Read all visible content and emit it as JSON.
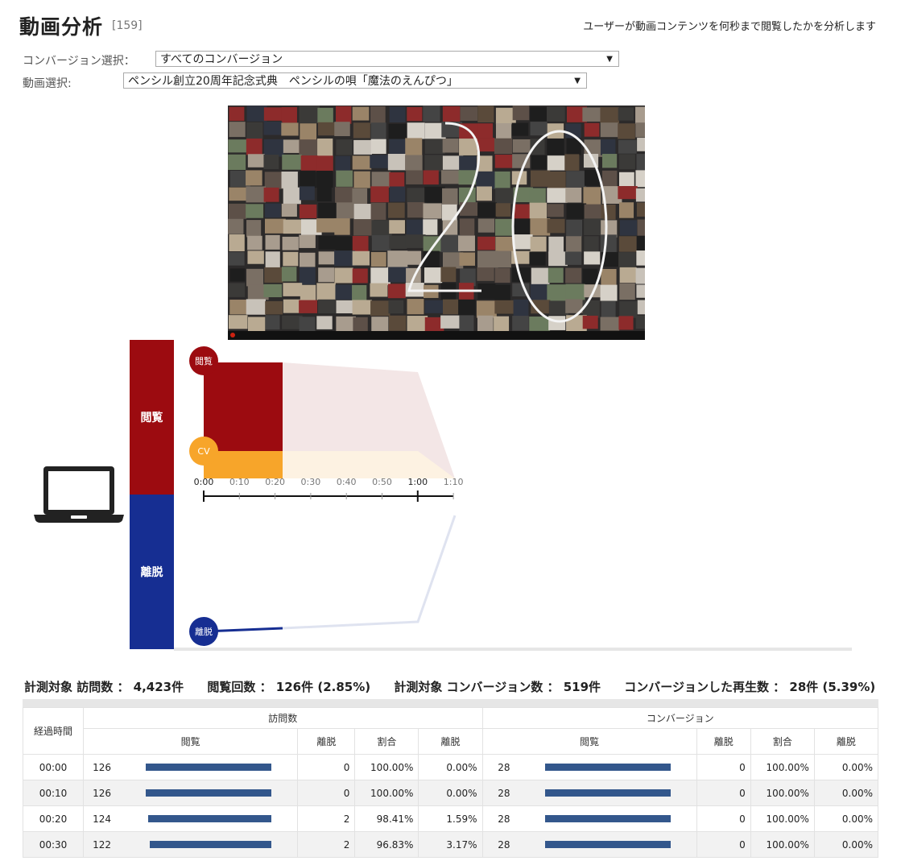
{
  "page": {
    "title": "動画分析",
    "count": "[159]",
    "description": "ユーザーが動画コンテンツを何秒まで閲覧したかを分析します"
  },
  "filters": {
    "conversion_label": "コンバージョン選択：",
    "conversion_value": "すべてのコンバージョン",
    "video_label": "動画選択:",
    "video_value": "ペンシル創立20周年記念式典　ペンシルの唄「魔法のえんぴつ」"
  },
  "device_icon": "laptop-icon",
  "flow": {
    "view_label": "閲覧",
    "leave_label": "離脱",
    "cv_label": "CV",
    "colors": {
      "view": "#9c0b10",
      "leave": "#162e92",
      "cv": "#f7a52a"
    }
  },
  "chart_data": {
    "type": "area",
    "x": [
      "0:00",
      "0:10",
      "0:20",
      "0:30",
      "0:40",
      "0:50",
      "1:00",
      "1:10"
    ],
    "series": [
      {
        "name": "閲覧",
        "values": [
          126,
          126,
          124,
          122,
          null,
          null,
          null,
          null
        ]
      },
      {
        "name": "CV",
        "values": [
          28,
          28,
          28,
          28,
          null,
          null,
          null,
          null
        ]
      },
      {
        "name": "離脱",
        "values": [
          0,
          0,
          2,
          2,
          null,
          null,
          null,
          null
        ]
      }
    ]
  },
  "stats": [
    "計測対象 訪問数 ： 4,423件",
    "閲覧回数 ： 126件 (2.85%)",
    "計測対象 コンバージョン数 ： 519件",
    "コンバージョンした再生数 ： 28件 (5.39%)"
  ],
  "table": {
    "time_header": "経過時間",
    "group_visits": "訪問数",
    "group_conversion": "コンバージョン",
    "sub_headers": [
      "閲覧",
      "離脱",
      "割合",
      "離脱"
    ],
    "max_view": 126,
    "rows": [
      {
        "time": "00:00",
        "v_view": 126,
        "v_leave": "0",
        "v_rate": "100.00%",
        "v_leave_rate": "0.00%",
        "c_view": 28,
        "c_leave": "0",
        "c_rate": "100.00%",
        "c_leave_rate": "0.00%"
      },
      {
        "time": "00:10",
        "v_view": 126,
        "v_leave": "0",
        "v_rate": "100.00%",
        "v_leave_rate": "0.00%",
        "c_view": 28,
        "c_leave": "0",
        "c_rate": "100.00%",
        "c_leave_rate": "0.00%"
      },
      {
        "time": "00:20",
        "v_view": 124,
        "v_leave": "2",
        "v_rate": "98.41%",
        "v_leave_rate": "1.59%",
        "c_view": 28,
        "c_leave": "0",
        "c_rate": "100.00%",
        "c_leave_rate": "0.00%"
      },
      {
        "time": "00:30",
        "v_view": 122,
        "v_leave": "2",
        "v_rate": "96.83%",
        "v_leave_rate": "3.17%",
        "c_view": 28,
        "c_leave": "0",
        "c_rate": "100.00%",
        "c_leave_rate": "0.00%"
      }
    ]
  }
}
